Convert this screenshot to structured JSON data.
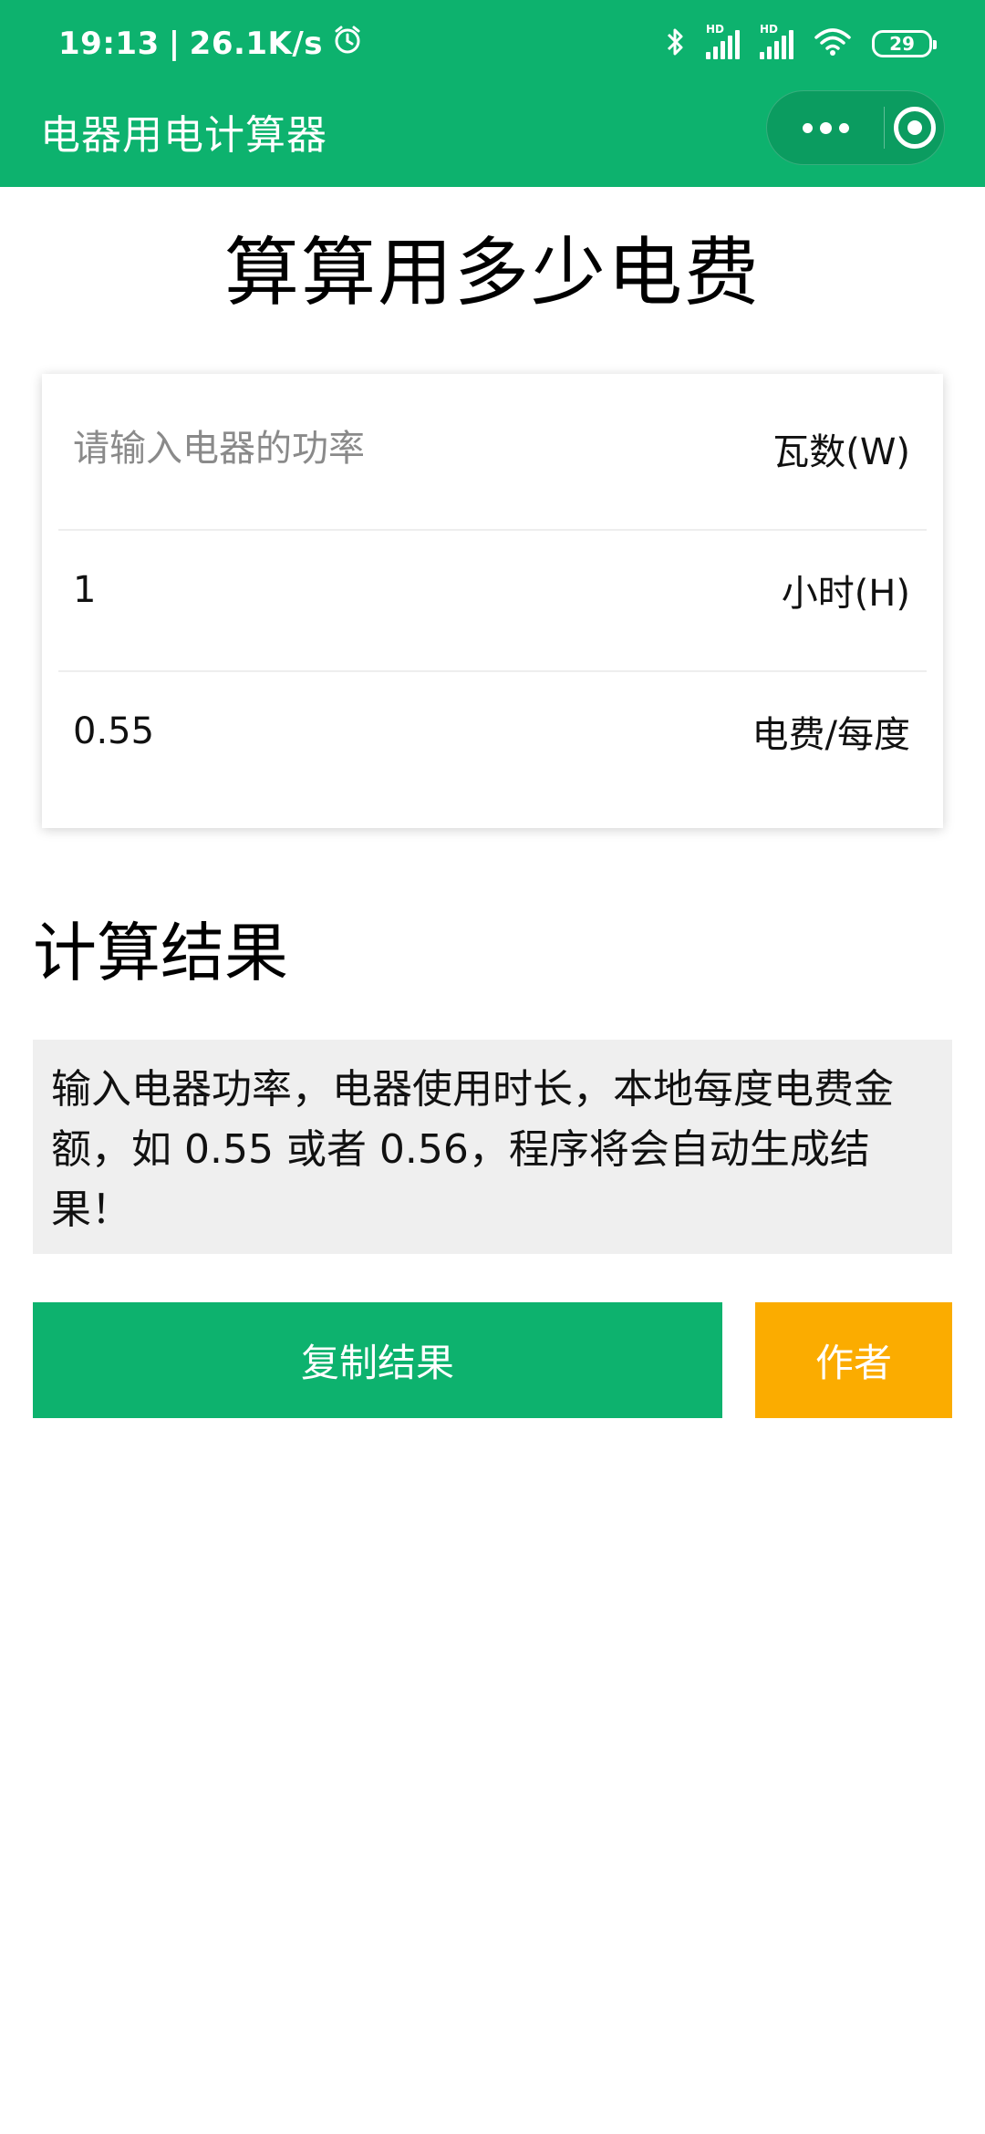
{
  "status_bar": {
    "time": "19:13",
    "net_speed": "26.1K/s",
    "battery": "29",
    "signal_label": "HD"
  },
  "nav": {
    "title": "电器用电计算器"
  },
  "page": {
    "heading": "算算用多少电费"
  },
  "form": {
    "power": {
      "value": "",
      "placeholder": "请输入电器的功率",
      "unit": "瓦数(W)"
    },
    "hours": {
      "value": "1",
      "placeholder": "",
      "unit": "小时(H)"
    },
    "price": {
      "value": "0.55",
      "placeholder": "",
      "unit": "电费/每度"
    }
  },
  "result": {
    "title": "计算结果",
    "text": "输入电器功率，电器使用时长，本地每度电费金额，如 0.55 或者 0.56，程序将会自动生成结果！"
  },
  "buttons": {
    "copy_label": "复制结果",
    "author_label": "作者"
  },
  "colors": {
    "brand_green": "#0db26e",
    "author_orange": "#fbac00",
    "result_bg": "#efefef"
  }
}
